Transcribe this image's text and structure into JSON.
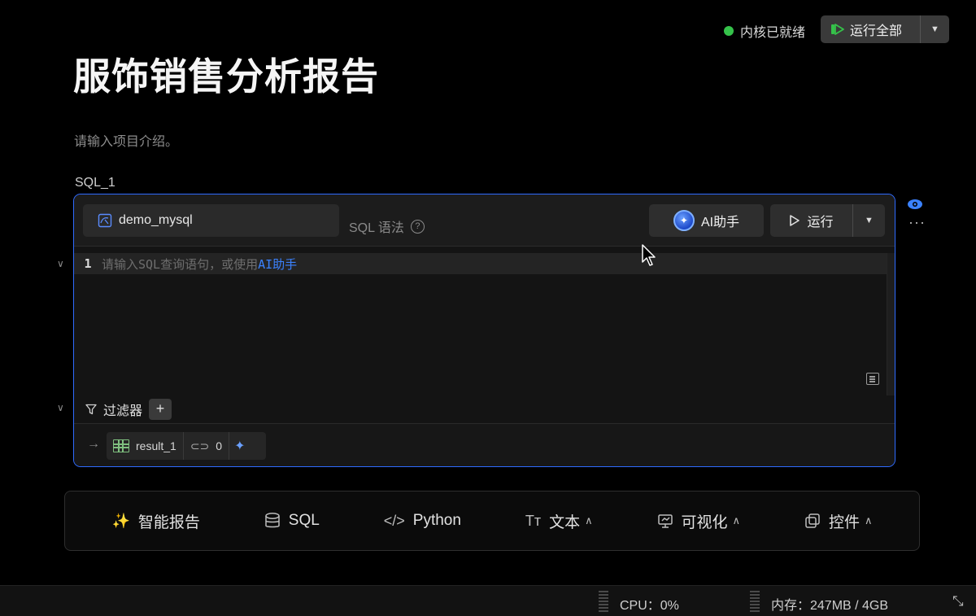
{
  "header": {
    "kernel_status": "内核已就绪",
    "run_all_label": "运行全部"
  },
  "page": {
    "title": "服饰销售分析报告",
    "intro_placeholder": "请输入项目介绍。"
  },
  "cell": {
    "name": "SQL_1",
    "datasource": "demo_mysql",
    "syntax_label": "SQL 语法",
    "ai_label": "AI助手",
    "run_label": "运行",
    "editor": {
      "line_number": "1",
      "placeholder_prefix": "请输入SQL查询语句，或使用",
      "placeholder_link": "AI助手"
    },
    "filter_label": "过滤器",
    "result_name": "result_1",
    "link_count": "0"
  },
  "toolbar": {
    "items": [
      {
        "label": "智能报告",
        "icon": "magic-wand-icon"
      },
      {
        "label": "SQL",
        "icon": "database-icon"
      },
      {
        "label": "Python",
        "icon": "code-icon"
      },
      {
        "label": "文本",
        "icon": "text-size-icon"
      },
      {
        "label": "可视化",
        "icon": "chart-icon"
      },
      {
        "label": "控件",
        "icon": "widget-icon"
      }
    ]
  },
  "status": {
    "cpu": "CPU：0%",
    "memory": "内存：247MB / 4GB"
  },
  "colors": {
    "accent": "#2f6bff",
    "kernel_ok": "#35c24a"
  }
}
